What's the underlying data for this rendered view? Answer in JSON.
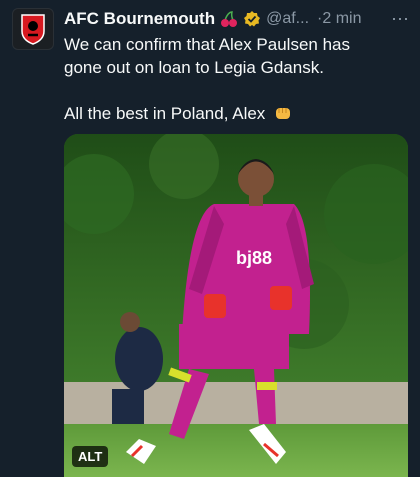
{
  "tweet": {
    "author_name": "AFC Bournemouth",
    "handle": "@af...",
    "time": "2 min",
    "separator": "·",
    "more_label": "⋯",
    "lines": [
      "We can confirm that Alex Paulsen has",
      "gone out on loan to Legia Gdansk.",
      "",
      "All the best in Poland, Alex"
    ],
    "icons": [
      "club-crest",
      "cherries-emoji",
      "verified-badge",
      "fist-emoji"
    ]
  },
  "media": {
    "alt_label": "ALT",
    "sponsor_text": "bj88"
  },
  "colors": {
    "background": "#15202b",
    "text": "#f7f9f9",
    "muted": "#8b98a5",
    "kit": "#c2218f",
    "verified": "#e8b923"
  }
}
